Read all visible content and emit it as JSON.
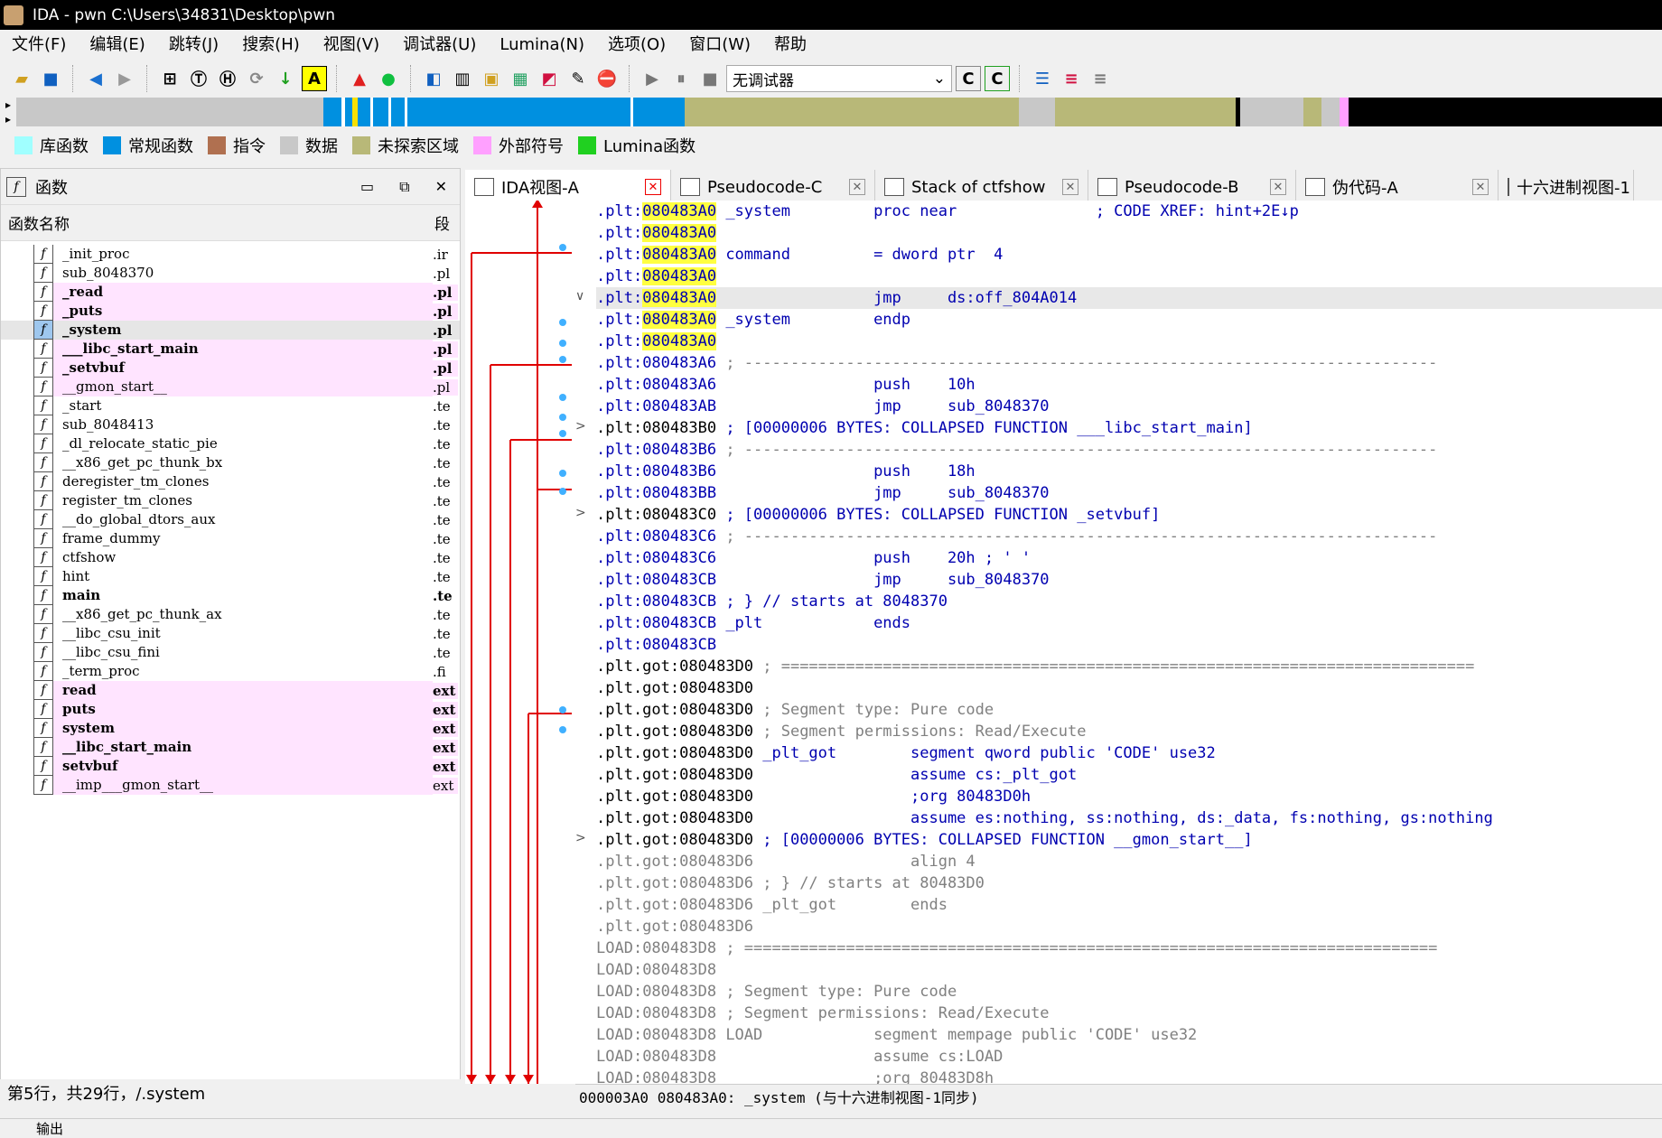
{
  "window": {
    "title": "IDA - pwn C:\\Users\\34831\\Desktop\\pwn"
  },
  "menu": [
    "文件(F)",
    "编辑(E)",
    "跳转(J)",
    "搜索(H)",
    "视图(V)",
    "调试器(U)",
    "Lumina(N)",
    "选项(O)",
    "窗口(W)",
    "帮助"
  ],
  "toolbar": {
    "debugger": "无调试器"
  },
  "legend": [
    {
      "label": "库函数",
      "color": "#a0ffff"
    },
    {
      "label": "常规函数",
      "color": "#0090e0"
    },
    {
      "label": "指令",
      "color": "#b07050"
    },
    {
      "label": "数据",
      "color": "#c8c8c8"
    },
    {
      "label": "未探索区域",
      "color": "#b8b878"
    },
    {
      "label": "外部符号",
      "color": "#ffa0ff"
    },
    {
      "label": "Lumina函数",
      "color": "#20d020"
    }
  ],
  "functions_panel": {
    "title": "函数",
    "col_name": "函数名称",
    "col_seg": "段",
    "status": "第5行，共29行，/.system",
    "rows": [
      {
        "name": "_init_proc",
        "seg": ".ir",
        "pink": false,
        "bold": false
      },
      {
        "name": "sub_8048370",
        "seg": ".pl",
        "pink": false,
        "bold": false
      },
      {
        "name": "_read",
        "seg": ".pl",
        "pink": true,
        "bold": true
      },
      {
        "name": "_puts",
        "seg": ".pl",
        "pink": true,
        "bold": true
      },
      {
        "name": "_system",
        "seg": ".pl",
        "pink": false,
        "bold": true,
        "selected": true
      },
      {
        "name": "___libc_start_main",
        "seg": ".pl",
        "pink": true,
        "bold": true
      },
      {
        "name": "_setvbuf",
        "seg": ".pl",
        "pink": true,
        "bold": true
      },
      {
        "name": "__gmon_start__",
        "seg": ".pl",
        "pink": true,
        "bold": false
      },
      {
        "name": "_start",
        "seg": ".te",
        "pink": false,
        "bold": false
      },
      {
        "name": "sub_8048413",
        "seg": ".te",
        "pink": false,
        "bold": false
      },
      {
        "name": "_dl_relocate_static_pie",
        "seg": ".te",
        "pink": false,
        "bold": false
      },
      {
        "name": "__x86_get_pc_thunk_bx",
        "seg": ".te",
        "pink": false,
        "bold": false
      },
      {
        "name": "deregister_tm_clones",
        "seg": ".te",
        "pink": false,
        "bold": false
      },
      {
        "name": "register_tm_clones",
        "seg": ".te",
        "pink": false,
        "bold": false
      },
      {
        "name": "__do_global_dtors_aux",
        "seg": ".te",
        "pink": false,
        "bold": false
      },
      {
        "name": "frame_dummy",
        "seg": ".te",
        "pink": false,
        "bold": false
      },
      {
        "name": "ctfshow",
        "seg": ".te",
        "pink": false,
        "bold": false
      },
      {
        "name": "hint",
        "seg": ".te",
        "pink": false,
        "bold": false
      },
      {
        "name": "main",
        "seg": ".te",
        "pink": false,
        "bold": true
      },
      {
        "name": "__x86_get_pc_thunk_ax",
        "seg": ".te",
        "pink": false,
        "bold": false
      },
      {
        "name": "__libc_csu_init",
        "seg": ".te",
        "pink": false,
        "bold": false
      },
      {
        "name": "__libc_csu_fini",
        "seg": ".te",
        "pink": false,
        "bold": false
      },
      {
        "name": "_term_proc",
        "seg": ".fi",
        "pink": false,
        "bold": false
      },
      {
        "name": "read",
        "seg": "ext",
        "pink": true,
        "bold": true
      },
      {
        "name": "puts",
        "seg": "ext",
        "pink": true,
        "bold": true
      },
      {
        "name": "system",
        "seg": "ext",
        "pink": true,
        "bold": true
      },
      {
        "name": "__libc_start_main",
        "seg": "ext",
        "pink": true,
        "bold": true
      },
      {
        "name": "setvbuf",
        "seg": "ext",
        "pink": true,
        "bold": true
      },
      {
        "name": "__imp___gmon_start__",
        "seg": "ext",
        "pink": true,
        "bold": false
      }
    ]
  },
  "tabs": [
    "IDA视图-A",
    "Pseudocode-C",
    "Stack of ctfshow",
    "Pseudocode-B",
    "伪代码-A",
    "十六进制视图-1"
  ],
  "code_lines": [
    {
      "seg": ".plt:",
      "addr": "080483A0",
      "yellow": true,
      "text": " _system         proc near               ; CODE XREF: hint+2E↓p"
    },
    {
      "seg": ".plt:",
      "addr": "080483A0",
      "yellow": true,
      "text": ""
    },
    {
      "seg": ".plt:",
      "addr": "080483A0",
      "yellow": true,
      "text": " command         = dword ptr  4"
    },
    {
      "seg": ".plt:",
      "addr": "080483A0",
      "yellow": true,
      "text": ""
    },
    {
      "seg": ".plt:",
      "addr": "080483A0",
      "yellow": true,
      "text": "                 jmp     ds:off_804A014",
      "hl": true,
      "fold": "∨"
    },
    {
      "seg": ".plt:",
      "addr": "080483A0",
      "yellow": true,
      "text": " _system         endp"
    },
    {
      "seg": ".plt:",
      "addr": "080483A0",
      "yellow": true,
      "text": ""
    },
    {
      "seg": ".plt:",
      "addr": "080483A6",
      "text": " ; ---------------------------------------------------------------------------"
    },
    {
      "seg": ".plt:",
      "addr": "080483A6",
      "text": "                 push    10h"
    },
    {
      "seg": ".plt:",
      "addr": "080483AB",
      "text": "                 jmp     sub_8048370"
    },
    {
      "seg": ".plt:",
      "addr": "080483B0",
      "text": " ; [00000006 BYTES: COLLAPSED FUNCTION ___libc_start_main]",
      "fold": ">",
      "dark": true
    },
    {
      "seg": ".plt:",
      "addr": "080483B6",
      "text": " ; ---------------------------------------------------------------------------"
    },
    {
      "seg": ".plt:",
      "addr": "080483B6",
      "text": "                 push    18h"
    },
    {
      "seg": ".plt:",
      "addr": "080483BB",
      "text": "                 jmp     sub_8048370"
    },
    {
      "seg": ".plt:",
      "addr": "080483C0",
      "text": " ; [00000006 BYTES: COLLAPSED FUNCTION _setvbuf]",
      "fold": ">",
      "dark": true
    },
    {
      "seg": ".plt:",
      "addr": "080483C6",
      "text": " ; ---------------------------------------------------------------------------"
    },
    {
      "seg": ".plt:",
      "addr": "080483C6",
      "text": "                 push    20h ; ' '"
    },
    {
      "seg": ".plt:",
      "addr": "080483CB",
      "text": "                 jmp     sub_8048370"
    },
    {
      "seg": ".plt:",
      "addr": "080483CB",
      "text": " ; } // starts at 8048370"
    },
    {
      "seg": ".plt:",
      "addr": "080483CB",
      "text": " _plt            ends"
    },
    {
      "seg": ".plt:",
      "addr": "080483CB",
      "text": ""
    },
    {
      "seg": ".plt.got:",
      "addr": "080483D0",
      "text": " ; ===========================================================================",
      "dark": true
    },
    {
      "seg": ".plt.got:",
      "addr": "080483D0",
      "text": "",
      "dark": true
    },
    {
      "seg": ".plt.got:",
      "addr": "080483D0",
      "text": " ; Segment type: Pure code",
      "dark": true
    },
    {
      "seg": ".plt.got:",
      "addr": "080483D0",
      "text": " ; Segment permissions: Read/Execute",
      "dark": true
    },
    {
      "seg": ".plt.got:",
      "addr": "080483D0",
      "text": " _plt_got        segment qword public 'CODE' use32",
      "dark": true
    },
    {
      "seg": ".plt.got:",
      "addr": "080483D0",
      "text": "                 assume cs:_plt_got",
      "dark": true
    },
    {
      "seg": ".plt.got:",
      "addr": "080483D0",
      "text": "                 ;org 80483D0h",
      "dark": true
    },
    {
      "seg": ".plt.got:",
      "addr": "080483D0",
      "text": "                 assume es:nothing, ss:nothing, ds:_data, fs:nothing, gs:nothing",
      "dark": true
    },
    {
      "seg": ".plt.got:",
      "addr": "080483D0",
      "text": " ; [00000006 BYTES: COLLAPSED FUNCTION __gmon_start__]",
      "fold": ">",
      "dark": true
    },
    {
      "seg": ".plt.got:",
      "addr": "080483D6",
      "text": "                 align 4",
      "gray": true
    },
    {
      "seg": ".plt.got:",
      "addr": "080483D6",
      "text": " ; } // starts at 80483D0",
      "gray": true
    },
    {
      "seg": ".plt.got:",
      "addr": "080483D6",
      "text": " _plt_got        ends",
      "gray": true
    },
    {
      "seg": ".plt.got:",
      "addr": "080483D6",
      "text": "",
      "gray": true
    },
    {
      "seg": "LOAD:",
      "addr": "080483D8",
      "text": " ; ===========================================================================",
      "gray": true
    },
    {
      "seg": "LOAD:",
      "addr": "080483D8",
      "text": "",
      "gray": true
    },
    {
      "seg": "LOAD:",
      "addr": "080483D8",
      "text": " ; Segment type: Pure code",
      "gray": true
    },
    {
      "seg": "LOAD:",
      "addr": "080483D8",
      "text": " ; Segment permissions: Read/Execute",
      "gray": true
    },
    {
      "seg": "LOAD:",
      "addr": "080483D8",
      "text": " LOAD            segment mempage public 'CODE' use32",
      "gray": true
    },
    {
      "seg": "LOAD:",
      "addr": "080483D8",
      "text": "                 assume cs:LOAD",
      "gray": true
    },
    {
      "seg": "LOAD:",
      "addr": "080483D8",
      "text": "                 ;org 80483D8h",
      "gray": true
    }
  ],
  "code_status": "000003A0 080483A0: _system (与十六进制视图-1同步)",
  "output_label": "输出"
}
